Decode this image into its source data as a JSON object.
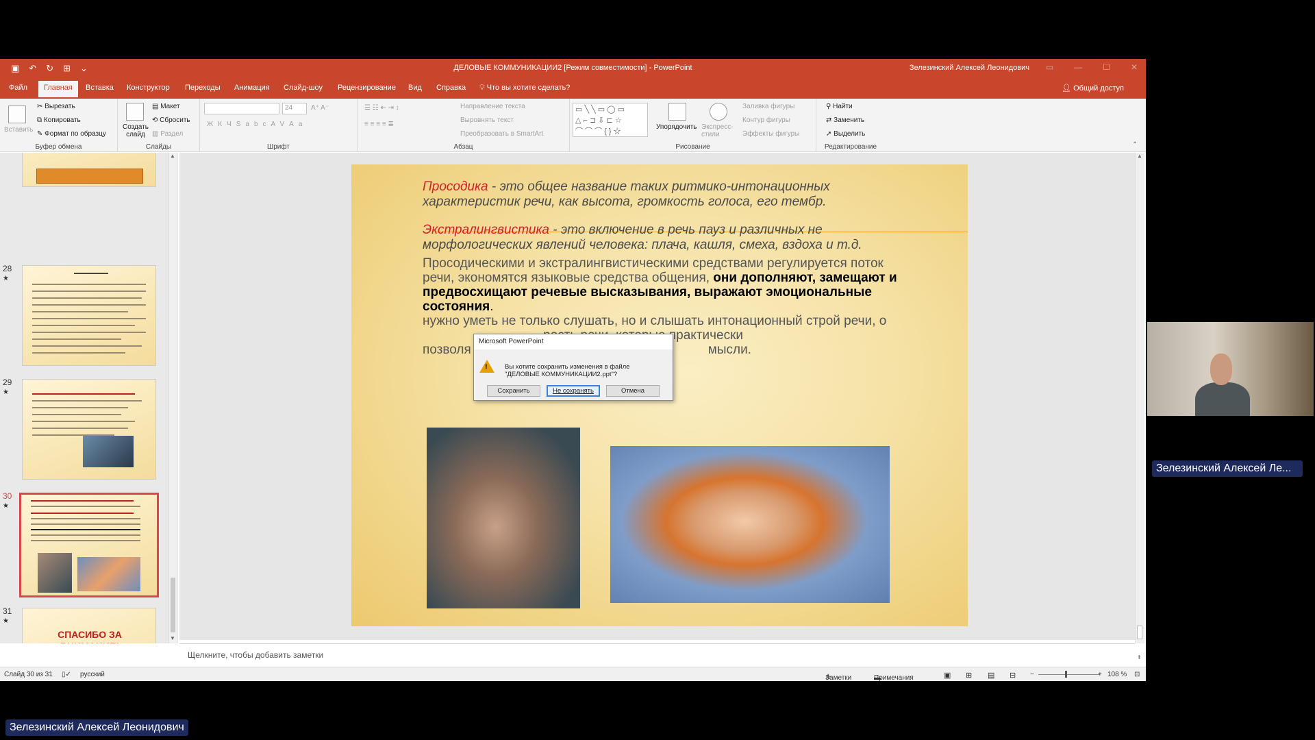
{
  "window": {
    "title": "ДЕЛОВЫЕ КОММУНИКАЦИИ2 [Режим совместимости]  -  PowerPoint",
    "user": "Зелезинский Алексей Леонидович"
  },
  "tabs": [
    "Файл",
    "Главная",
    "Вставка",
    "Конструктор",
    "Переходы",
    "Анимация",
    "Слайд-шоу",
    "Рецензирование",
    "Вид",
    "Справка"
  ],
  "tell_me": "Что вы хотите сделать?",
  "share": "Общий доступ",
  "ribbon": {
    "clipboard": {
      "paste": "Вставить",
      "cut": "Вырезать",
      "copy": "Копировать",
      "format_painter": "Формат по образцу",
      "label": "Буфер обмена"
    },
    "slides": {
      "new_slide": "Создать слайд",
      "layout": "Макет",
      "reset": "Сбросить",
      "section": "Раздел",
      "label": "Слайды"
    },
    "font": {
      "size": "24",
      "label": "Шрифт"
    },
    "paragraph": {
      "text_direction": "Направление текста",
      "align_text": "Выровнять текст",
      "smartart": "Преобразовать в SmartArt",
      "label": "Абзац"
    },
    "drawing": {
      "arrange": "Упорядочить",
      "quick_styles": "Экспресс-стили",
      "fill": "Заливка фигуры",
      "outline": "Контур фигуры",
      "effects": "Эффекты фигуры",
      "label": "Рисование"
    },
    "editing": {
      "find": "Найти",
      "replace": "Заменить",
      "select": "Выделить",
      "label": "Редактирование"
    }
  },
  "thumbnails": [
    {
      "num": "28"
    },
    {
      "num": "29"
    },
    {
      "num": "30"
    },
    {
      "num": "31",
      "text": "СПАСИБО ЗА ВНИМАНИЕ!"
    }
  ],
  "slide": {
    "p1_term": "Просодика",
    "p1_rest": " - это общее название таких ритмико-интонационных характеристик речи, как высота, громкость голоса, его тембр.",
    "p2_term": "Экстралингвистика",
    "p2_rest": " - это включение в речь пауз и различных не морфологических явлений человека: плача, кашля, смеха, вздоха и т.д.",
    "p3_a": "Просодическими и экстралингвистическими средствами регулируется поток речи, экономятся языковые средства общения, ",
    "p3_b": "они дополняют, замещают и предвосхищают речевые высказывания, выражают эмоциональные состояния",
    "p3_c": ".",
    "p4_a": "нужно уметь не только слушать, но и слышать интонационный строй речи, о",
    "p4_b": "рость речи, которые практически",
    "p4_c": "позволя",
    "p4_d": "мысли."
  },
  "dialog": {
    "title": "Microsoft PowerPoint",
    "message_1": "Вы хотите сохранить изменения в файле",
    "message_2": "\"ДЕЛОВЫЕ КОММУНИКАЦИИ2.ppt\"?",
    "save": "Сохранить",
    "dont_save": "Не сохранять",
    "cancel": "Отмена"
  },
  "notes_placeholder": "Щелкните, чтобы добавить заметки",
  "status": {
    "slide_info": "Слайд 30 из 31",
    "language": "русский",
    "notes": "Заметки",
    "comments": "Примечания",
    "zoom": "108 %"
  },
  "participant_short": "Зелезинский Алексей Ле...",
  "participant_full": "Зелезинский Алексей Леонидович",
  "colors": {
    "accent": "#c8462b",
    "selection": "#d9474a",
    "name_tag": "#1e2a5c"
  }
}
